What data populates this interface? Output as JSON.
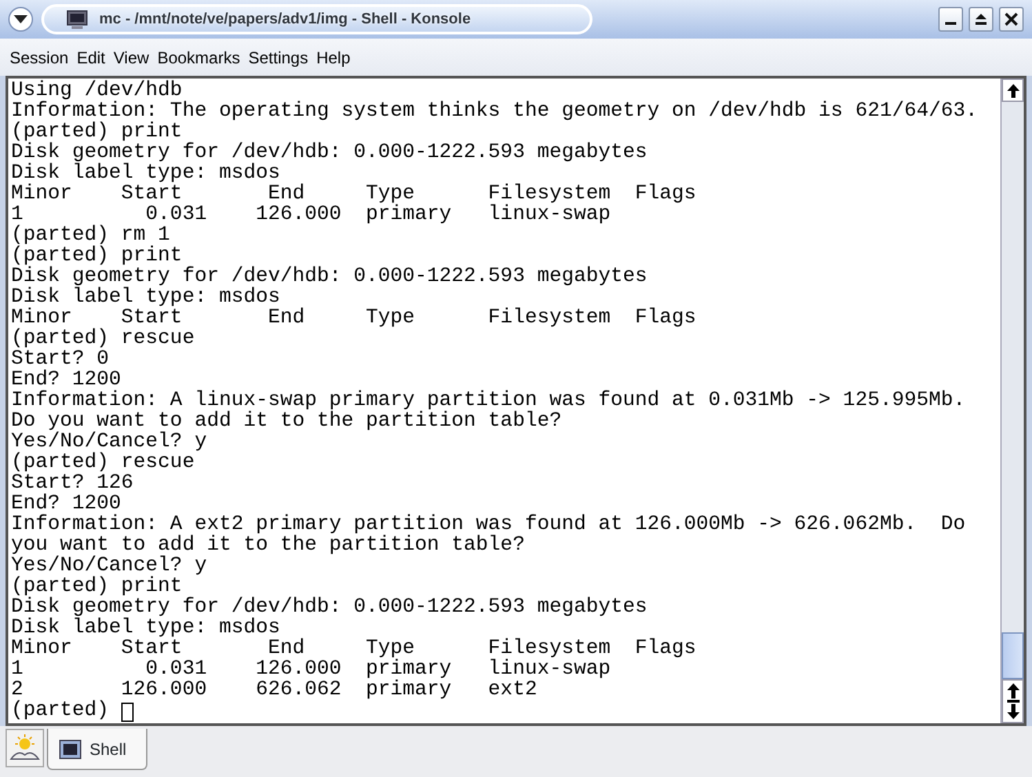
{
  "window": {
    "title": "mc - /mnt/note/ve/papers/adv1/img - Shell - Konsole"
  },
  "menu": [
    "Session",
    "Edit",
    "View",
    "Bookmarks",
    "Settings",
    "Help"
  ],
  "terminal": {
    "lines": [
      "Using /dev/hdb",
      "Information: The operating system thinks the geometry on /dev/hdb is 621/64/63.",
      "(parted) print",
      "Disk geometry for /dev/hdb: 0.000-1222.593 megabytes",
      "Disk label type: msdos",
      "Minor    Start       End     Type      Filesystem  Flags",
      "1          0.031    126.000  primary   linux-swap",
      "(parted) rm 1",
      "(parted) print",
      "Disk geometry for /dev/hdb: 0.000-1222.593 megabytes",
      "Disk label type: msdos",
      "Minor    Start       End     Type      Filesystem  Flags",
      "(parted) rescue",
      "Start? 0",
      "End? 1200",
      "Information: A linux-swap primary partition was found at 0.031Mb -> 125.995Mb.",
      "Do you want to add it to the partition table?",
      "Yes/No/Cancel? y",
      "(parted) rescue",
      "Start? 126",
      "End? 1200",
      "Information: A ext2 primary partition was found at 126.000Mb -> 626.062Mb.  Do",
      "you want to add it to the partition table?",
      "Yes/No/Cancel? y",
      "(parted) print",
      "Disk geometry for /dev/hdb: 0.000-1222.593 megabytes",
      "Disk label type: msdos",
      "Minor    Start       End     Type      Filesystem  Flags",
      "1          0.031    126.000  primary   linux-swap",
      "2        126.000    626.062  primary   ext2",
      "(parted) "
    ]
  },
  "tabs": [
    {
      "label": "Shell",
      "selected": true
    }
  ]
}
